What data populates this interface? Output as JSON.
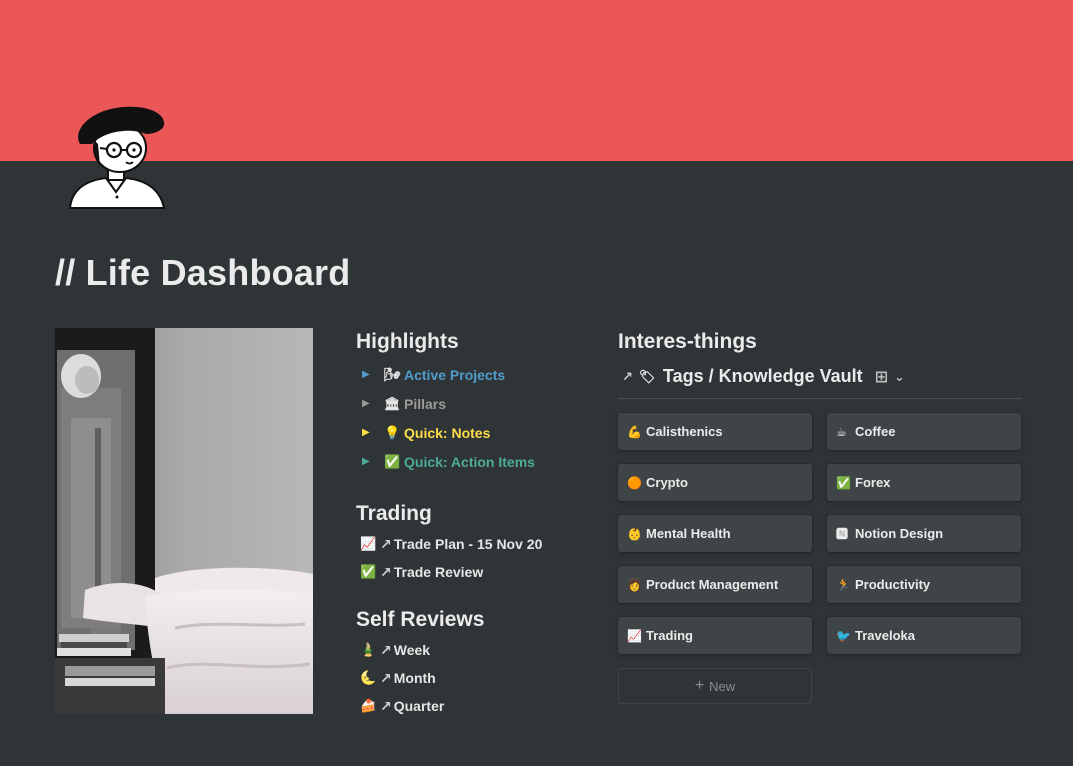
{
  "page": {
    "title": "// Life Dashboard",
    "cover_color": "#eb5757",
    "background": "#2f3437"
  },
  "highlights": {
    "heading": "Highlights",
    "items": [
      {
        "icon": "🌬",
        "label": "Active Projects",
        "color": "#529cca"
      },
      {
        "icon": "🏛",
        "label": "Pillars",
        "color": "#9b9a97"
      },
      {
        "icon": "💡",
        "label": "Quick: Notes",
        "color": "#ffdc49"
      },
      {
        "icon": "✅",
        "label": "Quick: Action Items",
        "color": "#4dab9a"
      }
    ]
  },
  "trading": {
    "heading": "Trading",
    "items": [
      {
        "icon": "📈",
        "arrow": "↗",
        "label": "Trade Plan - 15 Nov 20"
      },
      {
        "icon": "✅",
        "arrow": "↗",
        "label": "Trade Review"
      }
    ]
  },
  "self_reviews": {
    "heading": "Self Reviews",
    "items": [
      {
        "icon": "🎍",
        "arrow": "↗",
        "label": "Week"
      },
      {
        "icon": "🌜",
        "arrow": "↗",
        "label": "Month"
      },
      {
        "icon": "🍰",
        "arrow": "↗",
        "label": "Quarter"
      }
    ]
  },
  "interesthings": {
    "heading": "Interes-things",
    "db_arrow": "↗",
    "db_icon": "🏷",
    "db_title": "Tags / Knowledge Vault",
    "view_icon": "⊞",
    "chevron": "⌄",
    "cards": [
      {
        "icon": "💪",
        "label": "Calisthenics"
      },
      {
        "icon": "☕",
        "label": "Coffee"
      },
      {
        "icon": "🟠",
        "label": "Crypto"
      },
      {
        "icon": "✅",
        "label": "Forex"
      },
      {
        "icon": "👶",
        "label": "Mental Health"
      },
      {
        "icon": "🅽",
        "label": "Notion Design"
      },
      {
        "icon": "👩",
        "label": "Product Management"
      },
      {
        "icon": "🏃",
        "label": "Productivity"
      },
      {
        "icon": "📈",
        "label": "Trading"
      },
      {
        "icon": "🐦",
        "label": "Traveloka"
      }
    ],
    "new_plus": "+",
    "new_label": "New"
  }
}
